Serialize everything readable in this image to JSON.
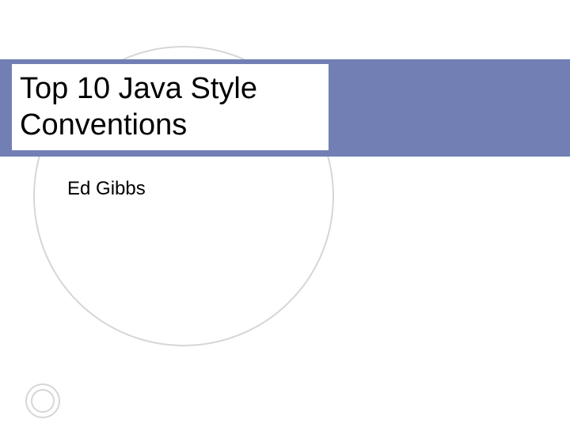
{
  "slide": {
    "title_line1": "Top 10 Java Style",
    "title_line2": "Conventions",
    "author": "Ed Gibbs"
  },
  "colors": {
    "band": "#727fb5",
    "circle_border": "#d6d6d6"
  }
}
